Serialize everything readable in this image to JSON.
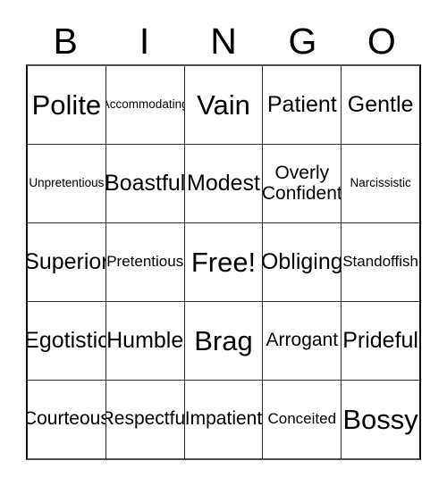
{
  "card": {
    "header": {
      "letters": [
        "B",
        "I",
        "N",
        "G",
        "O"
      ]
    },
    "grid": {
      "columns": 5,
      "rows": 5,
      "cells": [
        [
          {
            "label": "Polite",
            "size": "xl"
          },
          {
            "label": "Accommodating",
            "size": "xs"
          },
          {
            "label": "Vain",
            "size": "xl"
          },
          {
            "label": "Patient",
            "size": "lg"
          },
          {
            "label": "Gentle",
            "size": "lg"
          }
        ],
        [
          {
            "label": "Unpretentious",
            "size": "xs"
          },
          {
            "label": "Boastful",
            "size": "lg"
          },
          {
            "label": "Modest",
            "size": "lg"
          },
          {
            "label": "Overly\nConfident",
            "size": "md"
          },
          {
            "label": "Narcissistic",
            "size": "xs"
          }
        ],
        [
          {
            "label": "Superior",
            "size": "lg"
          },
          {
            "label": "Pretentious",
            "size": "sm"
          },
          {
            "label": "Free!",
            "size": "xl"
          },
          {
            "label": "Obliging",
            "size": "lg"
          },
          {
            "label": "Standoffish",
            "size": "sm"
          }
        ],
        [
          {
            "label": "Egotistic",
            "size": "lg"
          },
          {
            "label": "Humble",
            "size": "lg"
          },
          {
            "label": "Brag",
            "size": "xl"
          },
          {
            "label": "Arrogant",
            "size": "md"
          },
          {
            "label": "Prideful",
            "size": "lg"
          }
        ],
        [
          {
            "label": "Courteous",
            "size": "md"
          },
          {
            "label": "Respectful",
            "size": "md"
          },
          {
            "label": "Impatient",
            "size": "md"
          },
          {
            "label": "Conceited",
            "size": "sm"
          },
          {
            "label": "Bossy",
            "size": "xl"
          }
        ]
      ]
    },
    "colors": {
      "background": "#ffffff",
      "text": "#000000",
      "grid_line": "#2b2b2b",
      "grid_border": "#111111"
    }
  }
}
